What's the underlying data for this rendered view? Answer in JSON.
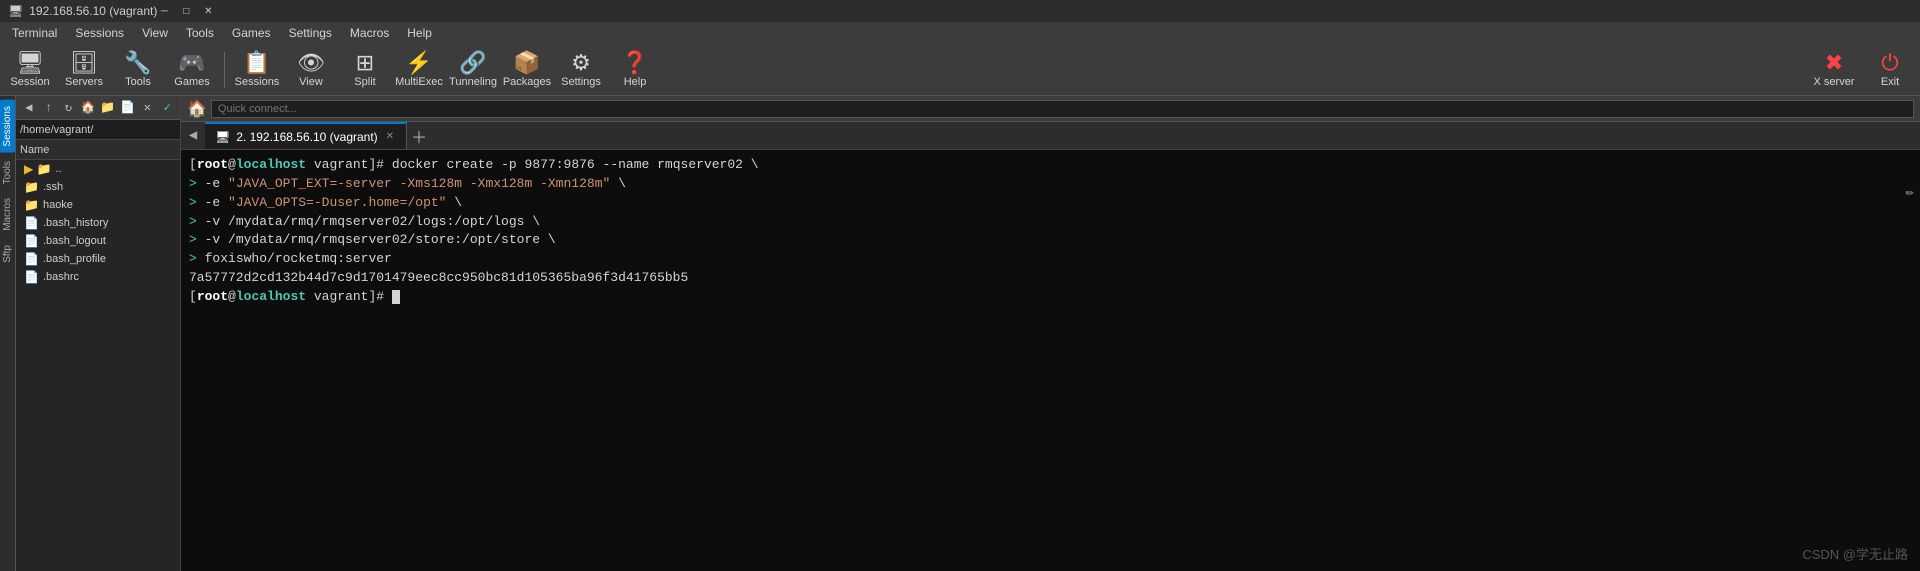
{
  "window": {
    "title": "192.168.56.10 (vagrant)",
    "titlebar_text": "192.168.56.10 (vagrant)"
  },
  "menubar": {
    "items": [
      "Terminal",
      "Sessions",
      "View",
      "Tools",
      "Games",
      "Settings",
      "Macros",
      "Help"
    ]
  },
  "toolbar": {
    "buttons": [
      {
        "label": "Session",
        "icon": "🖥"
      },
      {
        "label": "Servers",
        "icon": "🗄"
      },
      {
        "label": "Tools",
        "icon": "🔧"
      },
      {
        "label": "Games",
        "icon": "🎮"
      },
      {
        "label": "Sessions",
        "icon": "📋"
      },
      {
        "label": "View",
        "icon": "👁"
      },
      {
        "label": "Split",
        "icon": "⊞"
      },
      {
        "label": "MultiExec",
        "icon": "⚡"
      },
      {
        "label": "Tunneling",
        "icon": "🔗"
      },
      {
        "label": "Packages",
        "icon": "📦"
      },
      {
        "label": "Settings",
        "icon": "⚙"
      },
      {
        "label": "Help",
        "icon": "❓"
      }
    ],
    "right_buttons": [
      {
        "label": "X server",
        "icon": "✖"
      },
      {
        "label": "Exit",
        "icon": "⏻"
      }
    ]
  },
  "sidebar": {
    "vtabs": [
      "Sessions",
      "Tools",
      "Macros",
      "Sftp"
    ]
  },
  "file_panel": {
    "path": "/home/vagrant/",
    "header": "Name",
    "items": [
      {
        "name": "..",
        "type": "folder"
      },
      {
        "name": ".ssh",
        "type": "folder"
      },
      {
        "name": "haoke",
        "type": "folder"
      },
      {
        "name": ".bash_history",
        "type": "file"
      },
      {
        "name": ".bash_logout",
        "type": "file"
      },
      {
        "name": ".bash_profile",
        "type": "file"
      },
      {
        "name": ".bashrc",
        "type": "file"
      }
    ]
  },
  "tabs": [
    {
      "label": "2. 192.168.56.10 (vagrant)",
      "active": true
    }
  ],
  "quick_connect": {
    "placeholder": "Quick connect..."
  },
  "terminal": {
    "lines": [
      {
        "type": "cmd",
        "content": "[root@localhost vagrant]# docker create -p 9877:9876 --name rmqserver02 \\"
      },
      {
        "type": "cont",
        "content": "> -e \"JAVA_OPT_EXT=-server -Xms128m -Xmx128m -Xmn128m\" \\"
      },
      {
        "type": "cont",
        "content": "> -e \"JAVA_OPTS=-Duser.home=/opt\" \\"
      },
      {
        "type": "cont",
        "content": "> -v /mydata/rmq/rmqserver02/logs:/opt/logs \\"
      },
      {
        "type": "cont",
        "content": "> -v /mydata/rmq/rmqserver02/store:/opt/store \\"
      },
      {
        "type": "cont",
        "content": "> foxiswho/rocketmq:server"
      },
      {
        "type": "hash",
        "content": "7a57772d2cd132b44d7c9d1701479eec8cc950bc81d105365ba96f3d41765bb5"
      },
      {
        "type": "prompt",
        "content": "[root@localhost vagrant]# "
      }
    ]
  },
  "watermark": "CSDN @学无止路"
}
